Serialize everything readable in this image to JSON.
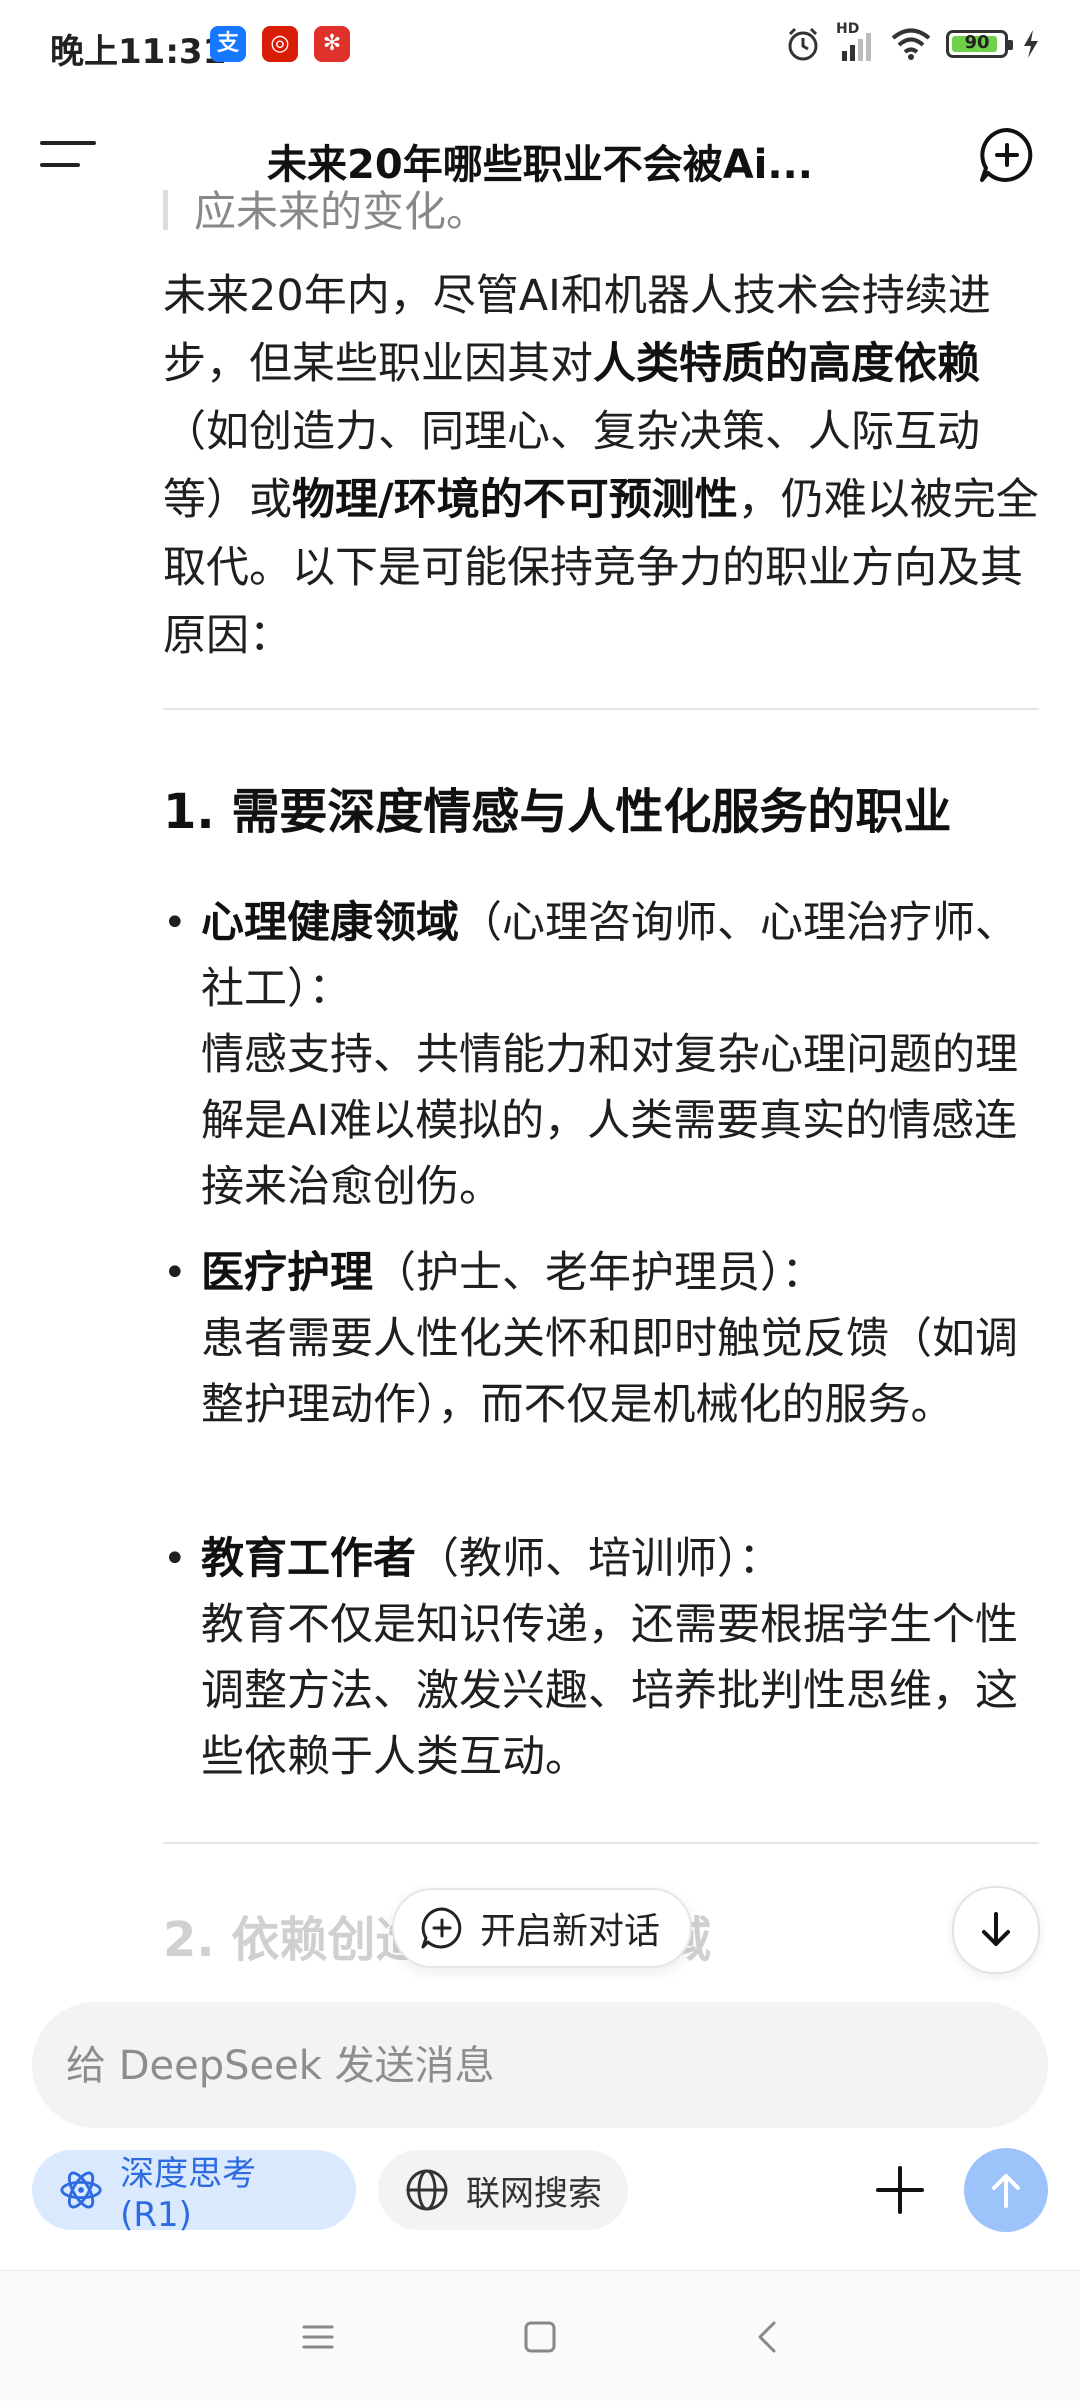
{
  "status_bar": {
    "time": "晚上11:31",
    "badges": [
      {
        "icon": "alipay-icon",
        "text": "支",
        "color": "#1677ff"
      },
      {
        "icon": "bank-icon",
        "text": "◎",
        "color": "#d81e06"
      },
      {
        "icon": "union-icon",
        "text": "✻",
        "color": "#e0322a"
      }
    ],
    "network_label": "HD",
    "battery": "90"
  },
  "header": {
    "title": "未来20年哪些职业不会被Ai..."
  },
  "content": {
    "quote_fragment": "应未来的变化。",
    "intro": {
      "p1": "未来20年内，尽管AI和机器人技术会持续进步，但某些职业因其对",
      "b1": "人类特质的高度依赖",
      "p2": "（如创造力、同理心、复杂决策、人际互动等）或",
      "b2": "物理/环境的不可预测性",
      "p3": "，仍难以被完全取代。以下是可能保持竞争力的职业方向及其原因："
    },
    "section1_title": "1. 需要深度情感与人性化服务的职业",
    "bullets": [
      {
        "title": "心理健康领域",
        "paren": "（心理咨询师、心理治疗师、社工）：",
        "body": "情感支持、共情能力和对复杂心理问题的理解是AI难以模拟的，人类需要真实的情感连接来治愈创伤。"
      },
      {
        "title": "医疗护理",
        "paren": "（护士、老年护理员）：",
        "body": "患者需要人性化关怀和即时触觉反馈（如调整护理动作），而不仅是机械化的服务。"
      },
      {
        "title": "教育工作者",
        "paren": "（教师、培训师）：",
        "body": "教育不仅是知识传递，还需要根据学生个性调整方法、激发兴趣、培养批判性思维，这些依赖于人类互动。"
      }
    ],
    "section2_title": "2. 依赖创造与表达的领域"
  },
  "new_chat_pill": "开启新对话",
  "composer": {
    "placeholder": "给 DeepSeek 发送消息",
    "deep_think": "深度思考 (R1)",
    "web_search": "联网搜索"
  },
  "colors": {
    "accent": "#2d6be0",
    "chip_bg": "#dbe9ff",
    "send_bg": "#9dc3fb"
  }
}
